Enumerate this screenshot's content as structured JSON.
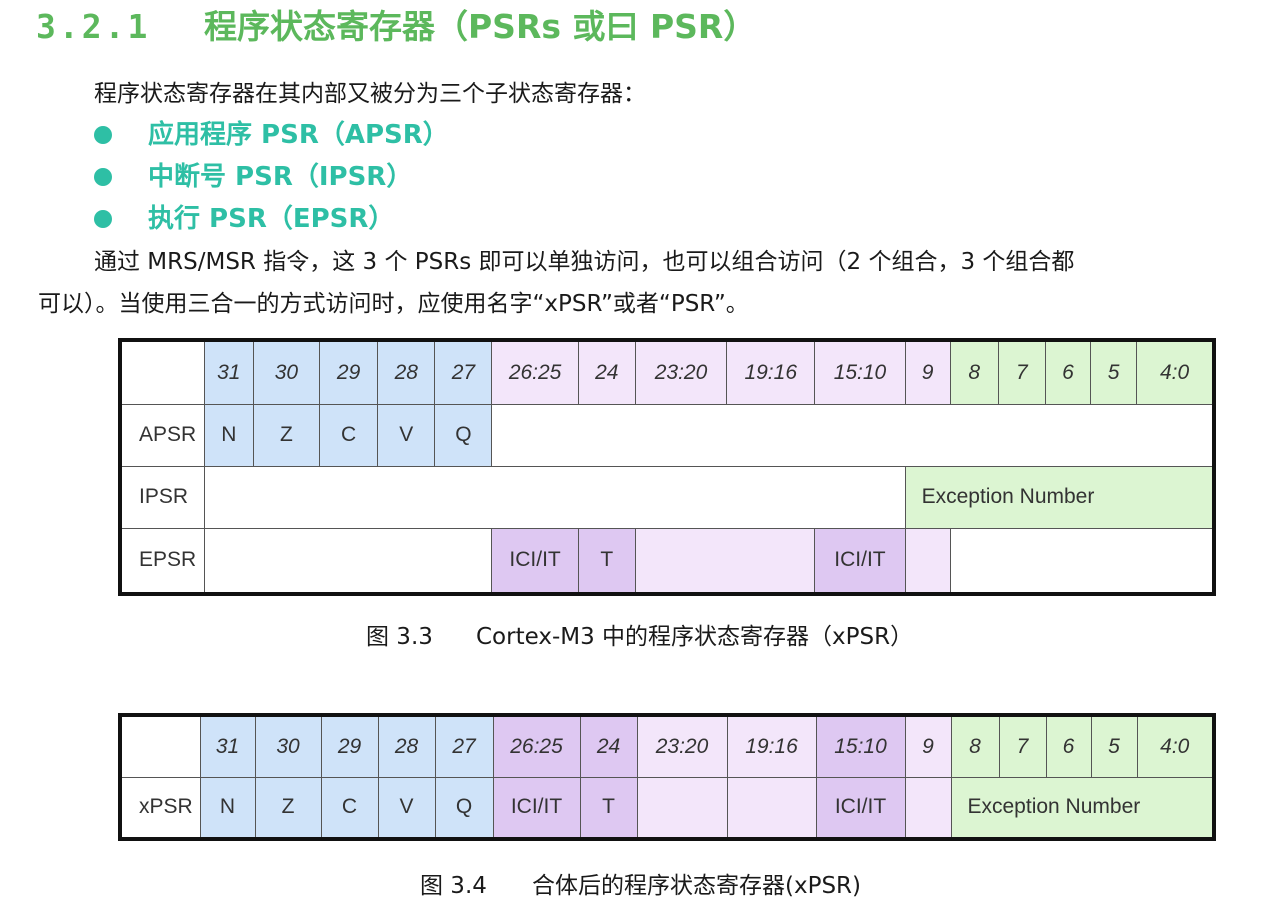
{
  "heading": {
    "number": "3.2.1",
    "title": "程序状态寄存器（PSRs 或曰 PSR）"
  },
  "intro": "程序状态寄存器在其内部又被分为三个子状态寄存器：",
  "bullets": [
    "应用程序 PSR（APSR）",
    "中断号 PSR（IPSR）",
    "执行 PSR（EPSR）"
  ],
  "para_line1": "通过 MRS/MSR 指令，这 3 个 PSRs 即可以单独访问，也可以组合访问（2 个组合，3 个组合都",
  "para_line2": "可以）。当使用三合一的方式访问时，应使用名字“xPSR”或者“PSR”。",
  "table1": {
    "bits": [
      "31",
      "30",
      "29",
      "28",
      "27",
      "26:25",
      "24",
      "23:20",
      "19:16",
      "15:10",
      "9",
      "8",
      "7",
      "6",
      "5",
      "4:0"
    ],
    "rows": {
      "apsr": {
        "label": "APSR",
        "flags": [
          "N",
          "Z",
          "C",
          "V",
          "Q"
        ]
      },
      "ipsr": {
        "label": "IPSR",
        "exception": "Exception Number"
      },
      "epsr": {
        "label": "EPSR",
        "ici1": "ICI/IT",
        "t": "T",
        "ici2": "ICI/IT"
      }
    }
  },
  "caption1": {
    "fig": "图 3.3",
    "text": "Cortex-M3 中的程序状态寄存器（xPSR）"
  },
  "table2": {
    "bits": [
      "31",
      "30",
      "29",
      "28",
      "27",
      "26:25",
      "24",
      "23:20",
      "19:16",
      "15:10",
      "9",
      "8",
      "7",
      "6",
      "5",
      "4:0"
    ],
    "row": {
      "label": "xPSR",
      "flags": [
        "N",
        "Z",
        "C",
        "V",
        "Q"
      ],
      "ici1": "ICI/IT",
      "t": "T",
      "ici2": "ICI/IT",
      "exception": "Exception Number"
    }
  },
  "caption2": {
    "fig": "图 3.4",
    "text": "合体后的程序状态寄存器(xPSR)"
  },
  "colors": {
    "heading": "#5cb85c",
    "bullet": "#2ebfa5",
    "blue": "#cfe3f9",
    "lavender": "#f3e6fa",
    "purple": "#dec8f2",
    "green": "#dcf5d2"
  }
}
